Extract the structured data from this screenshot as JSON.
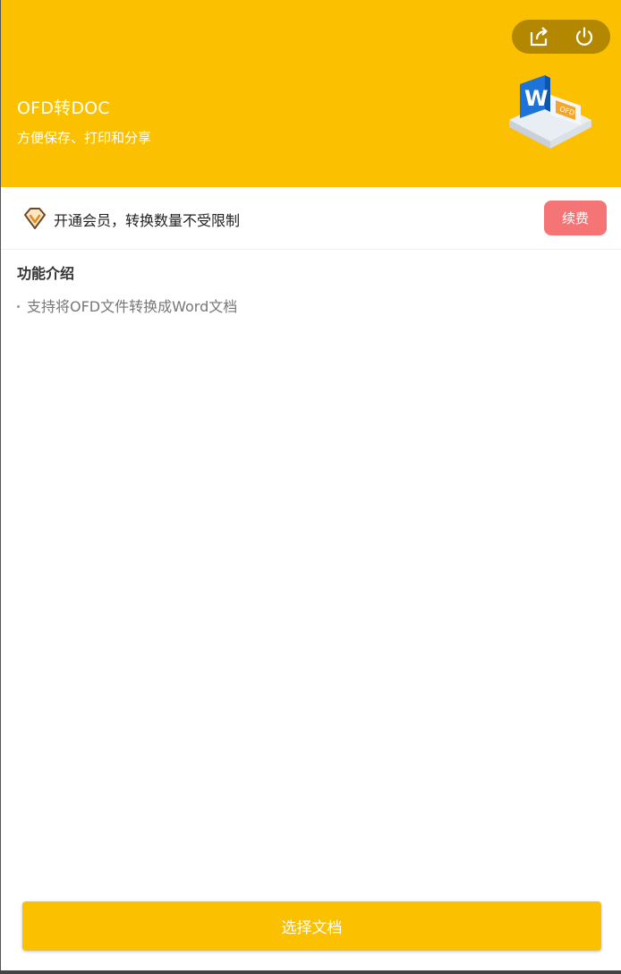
{
  "header": {
    "title": "OFD转DOC",
    "subtitle": "方便保存、打印和分享",
    "background_color": "#fbc000",
    "controls": [
      {
        "icon": "share-icon"
      },
      {
        "icon": "power-icon"
      }
    ],
    "illustration": {
      "icon": "ofd-to-word-illustration",
      "word_letter": "W",
      "ofd_label": "OFD"
    }
  },
  "member": {
    "icon": "vip-diamond-icon",
    "text": "开通会员，转换数量不受限制",
    "renew_label": "续费",
    "renew_color": "#f57475"
  },
  "features": {
    "heading": "功能介绍",
    "items": [
      "支持将OFD文件转换成Word文档"
    ]
  },
  "footer": {
    "select_label": "选择文档"
  }
}
